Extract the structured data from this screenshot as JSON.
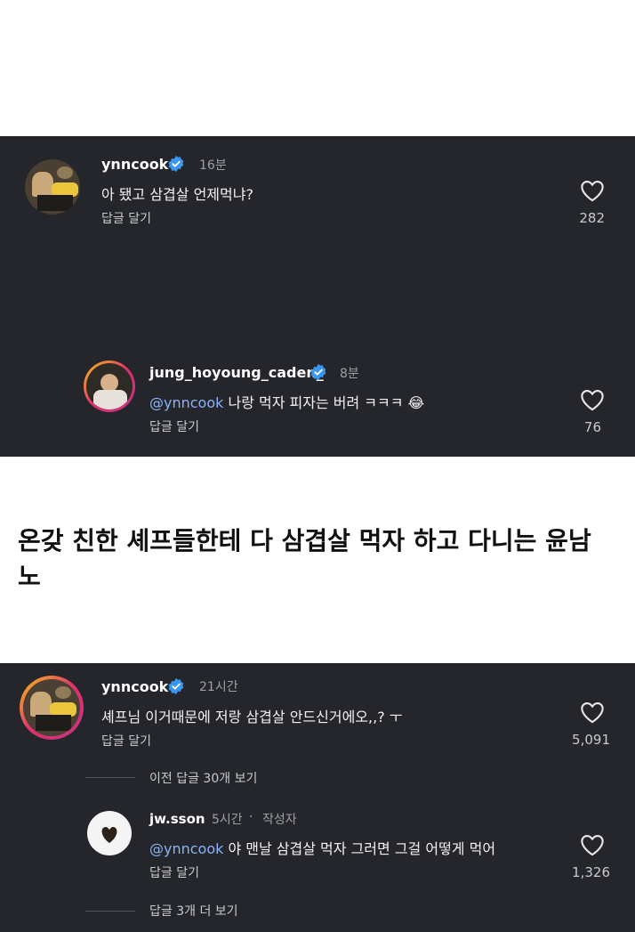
{
  "thread1": {
    "comment": {
      "username": "ynncook",
      "time": "16분",
      "text": "아 됐고 삼겹살 언제먹냐?",
      "reply_label": "답글 달기",
      "likes": "282"
    },
    "reply": {
      "username": "jung_hoyoung_caden_",
      "time": "8분",
      "mention": "@ynncook",
      "text": " 나랑 먹자 피자는 버려 ㅋㅋㅋ 😂",
      "reply_label": "답글 달기",
      "likes": "76"
    }
  },
  "headline": "온갖 친한 셰프들한테 다 삼겹살 먹자 하고 다니는 윤남노",
  "thread2": {
    "comment": {
      "username": "ynncook",
      "time": "21시간",
      "text": "셰프님 이거때문에 저랑 삼겹살 안드신거에오,,? ㅜ",
      "reply_label": "답글 달기",
      "likes": "5,091"
    },
    "view_previous": "이전 답글 30개 보기",
    "reply": {
      "username": "jw.sson",
      "time": "5시간",
      "author_badge": "작성자",
      "mention": "@ynncook",
      "text": " 야 맨날 삼겹살 먹자 그러면 그걸 어떻게 먹어",
      "reply_label": "답글 달기",
      "likes": "1,326"
    },
    "view_more": "답글 3개 더 보기"
  },
  "colors": {
    "panel_bg": "#25262b",
    "verified_blue": "#3897f0",
    "mention_blue": "#8ab4f8",
    "muted_text": "#9ea0a6"
  },
  "icons": [
    "verified-badge-icon",
    "heart-icon"
  ]
}
